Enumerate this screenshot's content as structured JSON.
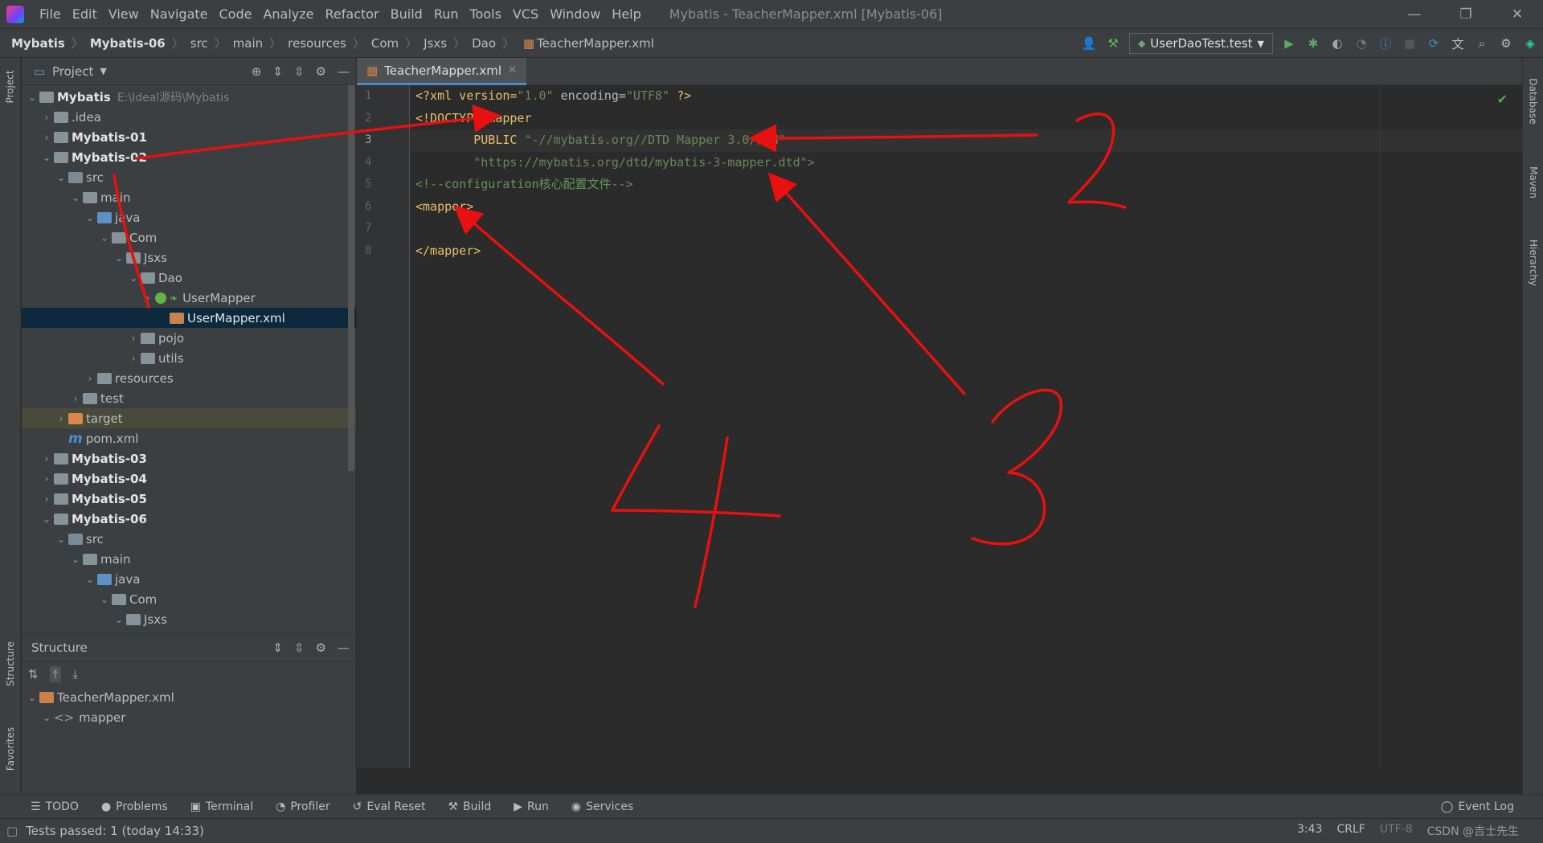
{
  "menubar": {
    "items": [
      "File",
      "Edit",
      "View",
      "Navigate",
      "Code",
      "Analyze",
      "Refactor",
      "Build",
      "Run",
      "Tools",
      "VCS",
      "Window",
      "Help"
    ],
    "title": "Mybatis - TeacherMapper.xml [Mybatis-06]"
  },
  "breadcrumbs": [
    "Mybatis",
    "Mybatis-06",
    "src",
    "main",
    "resources",
    "Com",
    "Jsxs",
    "Dao",
    "TeacherMapper.xml"
  ],
  "run_config": "UserDaoTest.test",
  "project": {
    "title": "Project",
    "tree": [
      {
        "label": "Mybatis",
        "path": "E:\\Ideal源码\\Mybatis",
        "bold": true
      },
      {
        "label": ".idea"
      },
      {
        "label": "Mybatis-01",
        "bold": true
      },
      {
        "label": "Mybatis-02",
        "bold": true
      },
      {
        "label": "src"
      },
      {
        "label": "main"
      },
      {
        "label": "java"
      },
      {
        "label": "Com"
      },
      {
        "label": "Jsxs"
      },
      {
        "label": "Dao"
      },
      {
        "label": "UserMapper"
      },
      {
        "label": "UserMapper.xml"
      },
      {
        "label": "pojo"
      },
      {
        "label": "utils"
      },
      {
        "label": "resources"
      },
      {
        "label": "test"
      },
      {
        "label": "target"
      },
      {
        "label": "pom.xml"
      },
      {
        "label": "Mybatis-03",
        "bold": true
      },
      {
        "label": "Mybatis-04",
        "bold": true
      },
      {
        "label": "Mybatis-05",
        "bold": true
      },
      {
        "label": "Mybatis-06",
        "bold": true
      },
      {
        "label": "src"
      },
      {
        "label": "main"
      },
      {
        "label": "java"
      },
      {
        "label": "Com"
      },
      {
        "label": "Jsxs"
      }
    ]
  },
  "structure": {
    "title": "Structure",
    "items": [
      "TeacherMapper.xml",
      "mapper"
    ]
  },
  "editor": {
    "tab": "TeacherMapper.xml",
    "line_numbers": [
      "1",
      "2",
      "3",
      "4",
      "5",
      "6",
      "7",
      "8"
    ],
    "lines": {
      "l1_a": "<?xml version=",
      "l1_b": "\"1.0\"",
      "l1_c": " encoding=",
      "l1_d": "\"UTF8\"",
      "l1_e": " ?>",
      "l2": "<!DOCTYPE mapper",
      "l3_a": "        PUBLIC ",
      "l3_b": "\"-//mybatis.org//DTD Mapper 3.0//EN\"",
      "l4": "        \"https://mybatis.org/dtd/mybatis-3-mapper.dtd\">",
      "l5": "<!--configuration核心配置文件-->",
      "l6": "<mapper>",
      "l7": "",
      "l8": "</mapper>"
    }
  },
  "tool_tabs": [
    "TODO",
    "Problems",
    "Terminal",
    "Profiler",
    "Eval Reset",
    "Build",
    "Run",
    "Services",
    "Event Log"
  ],
  "status": {
    "message": "Tests passed: 1 (today 14:33)",
    "position": "3:43",
    "line_sep": "CRLF",
    "encoding": "UTF-8",
    "watermark": "CSDN @吉士先生"
  },
  "stripe": {
    "left": [
      "Project",
      "Structure",
      "Favorites"
    ],
    "right": [
      "Database",
      "Maven",
      "Hierarchy"
    ]
  },
  "annotations": [
    "2",
    "3",
    "4"
  ]
}
